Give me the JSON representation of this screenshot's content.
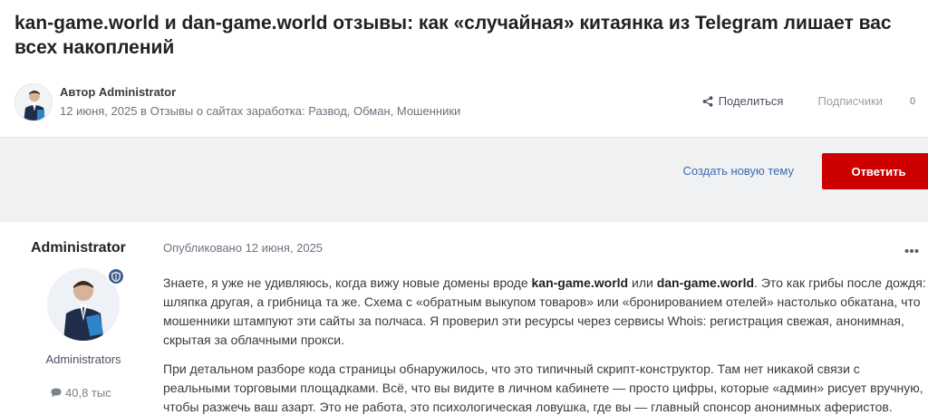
{
  "topic": {
    "title": "kan-game.world и dan-game.world отзывы: как «случайная» китаянка из Telegram лишает вас всех накоплений"
  },
  "meta": {
    "author_line": "Автор Administrator",
    "date_line": "12 июня, 2025 в Отзывы о сайтах заработка: Развод, Обман, Мошенники",
    "share_label": "Поделиться",
    "followers_label": "Подписчики",
    "followers_count": "0"
  },
  "actions": {
    "new_topic_label": "Создать новую тему",
    "reply_label": "Ответить"
  },
  "post": {
    "author_name": "Administrator",
    "group": "Administrators",
    "post_count": "40,8 тыс",
    "published": "Опубликовано 12 июня, 2025",
    "p1": [
      "Знаете, я уже не удивляюсь, когда вижу новые домены вроде ",
      "kan-game.world",
      " или ",
      "dan-game.world",
      ". Это как грибы после дождя: шляпка другая, а грибница та же. Схема с «обратным выкупом товаров» или «бронированием отелей» настолько обкатана, что мошенники штампуют эти сайты за полчаса. Я проверил эти ресурсы через сервисы Whois: регистрация свежая, анонимная, скрытая за облачными прокси."
    ],
    "p2": "При детальном разборе кода страницы обнаружилось, что это типичный скрипт-конструктор. Там нет никакой связи с реальными торговыми площадками. Всё, что вы видите в личном кабинете — просто цифры, которые «админ» рисует вручную, чтобы разжечь ваш азарт. Это не работа, это психологическая ловушка, где вы — главный спонсор анонимных аферистов."
  },
  "colors": {
    "accent_red": "#cc0000",
    "link_blue": "#3c6bb0",
    "bar_bg": "#f0f1f3"
  },
  "icons": {
    "share": "share-icon",
    "more": "more-horizontal-icon",
    "comment": "comment-icon",
    "badge": "moderator-shield-icon"
  }
}
